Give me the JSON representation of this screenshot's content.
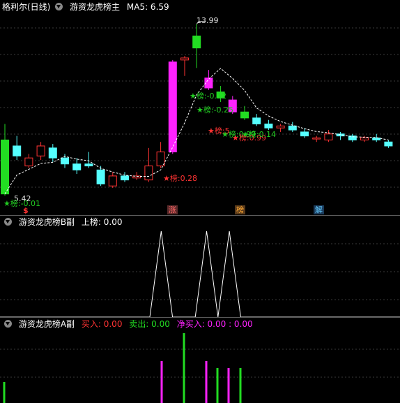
{
  "main": {
    "stock_name": "格利尔(日线)",
    "indicator_name": "游资龙虎榜主",
    "ma_label": "MA5: 6.59",
    "high_label": "13.99",
    "low_label": "5.42",
    "annotations": [
      {
        "text": "★榜:-0.12",
        "color": "#22cc22"
      },
      {
        "text": "★榜:-0.25",
        "color": "#22cc22"
      },
      {
        "text": "★榜:5",
        "color": "#ff3333"
      },
      {
        "text": "★榜:0.99",
        "color": "#22cc22"
      },
      {
        "text": "★榜:0.99",
        "color": "#ff3333"
      },
      {
        "text": "★榜:0.14",
        "color": "#22cc22"
      },
      {
        "text": "★榜:0.28",
        "color": "#ff3333"
      },
      {
        "text": "★榜:-0.01",
        "color": "#22cc22"
      }
    ],
    "bottom_markers": [
      {
        "text": "$",
        "color": "#ff3333",
        "bg": "transparent"
      },
      {
        "text": "涨",
        "color": "#ff6666",
        "bg": "#5a2a2a"
      },
      {
        "text": "榜",
        "color": "#ffaa33",
        "bg": "#5a3a1a"
      },
      {
        "text": "解",
        "color": "#66ccff",
        "bg": "#1a3a5a"
      }
    ]
  },
  "panel_b": {
    "title": "游资龙虎榜B副",
    "value_label": "上榜: 0.00"
  },
  "panel_a": {
    "title": "游资龙虎榜A副",
    "buy_label": "买入: 0.00",
    "sell_label": "卖出: 0.00",
    "net_label": "净买入: 0.00 : 0.00"
  },
  "colors": {
    "up_red": "#ff3333",
    "down_cyan": "#55ffff",
    "green": "#22dd22",
    "magenta": "#ff22ff",
    "ma_line": "#ffffff"
  },
  "chart_data": [
    {
      "type": "candlestick",
      "title": "格利尔(日线)",
      "series": [
        {
          "name": "MA5",
          "values": [
            6.59
          ]
        }
      ],
      "candles": [
        {
          "o": 8.2,
          "c": 5.5,
          "h": 9.0,
          "l": 5.42
        },
        {
          "o": 7.9,
          "c": 7.4,
          "h": 8.4,
          "l": 7.2
        },
        {
          "o": 6.9,
          "c": 7.3,
          "h": 7.5,
          "l": 6.8
        },
        {
          "o": 7.4,
          "c": 7.9,
          "h": 8.1,
          "l": 7.2
        },
        {
          "o": 7.8,
          "c": 7.3,
          "h": 8.0,
          "l": 7.1
        },
        {
          "o": 7.3,
          "c": 7.0,
          "h": 7.5,
          "l": 6.8
        },
        {
          "o": 7.0,
          "c": 6.7,
          "h": 7.3,
          "l": 6.5
        },
        {
          "o": 7.0,
          "c": 6.9,
          "h": 7.6,
          "l": 6.8
        },
        {
          "o": 6.7,
          "c": 6.0,
          "h": 6.9,
          "l": 5.9
        },
        {
          "o": 5.9,
          "c": 6.4,
          "h": 6.6,
          "l": 5.8
        },
        {
          "o": 6.4,
          "c": 6.2,
          "h": 6.6,
          "l": 6.1
        },
        {
          "o": 6.3,
          "c": 6.4,
          "h": 6.6,
          "l": 6.2
        },
        {
          "o": 6.2,
          "c": 6.9,
          "h": 7.8,
          "l": 6.1
        },
        {
          "o": 6.9,
          "c": 7.6,
          "h": 8.1,
          "l": 6.8
        },
        {
          "o": 7.6,
          "c": 12.1,
          "h": 12.2,
          "l": 7.5
        },
        {
          "o": 12.2,
          "c": 12.3,
          "h": 12.4,
          "l": 11.4
        },
        {
          "o": 12.8,
          "c": 13.4,
          "h": 13.99,
          "l": 11.8
        },
        {
          "o": 11.3,
          "c": 10.8,
          "h": 11.7,
          "l": 10.7
        },
        {
          "o": 10.6,
          "c": 10.3,
          "h": 10.9,
          "l": 10.1
        },
        {
          "o": 10.2,
          "c": 9.6,
          "h": 10.4,
          "l": 9.5
        },
        {
          "o": 9.6,
          "c": 9.3,
          "h": 9.9,
          "l": 9.2
        },
        {
          "o": 9.3,
          "c": 9.0,
          "h": 9.5,
          "l": 8.9
        },
        {
          "o": 9.0,
          "c": 8.8,
          "h": 9.2,
          "l": 8.7
        },
        {
          "o": 8.8,
          "c": 8.9,
          "h": 9.0,
          "l": 8.6
        },
        {
          "o": 8.9,
          "c": 8.7,
          "h": 9.1,
          "l": 8.6
        },
        {
          "o": 8.6,
          "c": 8.4,
          "h": 8.8,
          "l": 8.3
        },
        {
          "o": 8.3,
          "c": 8.3,
          "h": 8.4,
          "l": 8.1
        },
        {
          "o": 8.2,
          "c": 8.5,
          "h": 8.7,
          "l": 8.1
        },
        {
          "o": 8.5,
          "c": 8.4,
          "h": 8.6,
          "l": 8.2
        },
        {
          "o": 8.4,
          "c": 8.2,
          "h": 8.5,
          "l": 8.1
        },
        {
          "o": 8.2,
          "c": 8.3,
          "h": 8.4,
          "l": 8.1
        },
        {
          "o": 8.3,
          "c": 8.2,
          "h": 8.5,
          "l": 8.1
        },
        {
          "o": 8.1,
          "c": 7.9,
          "h": 8.2,
          "l": 7.8
        }
      ]
    },
    {
      "type": "line",
      "title": "游资龙虎榜B副",
      "series": [
        {
          "name": "上榜",
          "values": [
            0,
            0,
            0,
            0,
            0,
            0,
            0,
            0,
            0,
            0,
            0,
            0,
            0,
            1,
            0,
            0,
            0,
            1,
            0,
            1,
            0,
            0,
            0,
            0,
            0,
            0,
            0,
            0,
            0,
            0,
            0,
            0,
            0
          ]
        }
      ]
    },
    {
      "type": "bar",
      "title": "游资龙虎榜A副",
      "series": [
        {
          "name": "买入",
          "values": [
            0.3,
            0,
            0,
            0,
            0,
            0,
            0,
            0,
            0,
            0,
            0,
            0,
            0,
            0.6,
            0,
            0,
            1,
            0.6,
            0.5,
            0.5,
            0.5,
            0,
            0,
            0,
            0,
            0,
            0,
            0,
            0,
            0,
            0,
            0,
            0
          ]
        }
      ]
    }
  ]
}
